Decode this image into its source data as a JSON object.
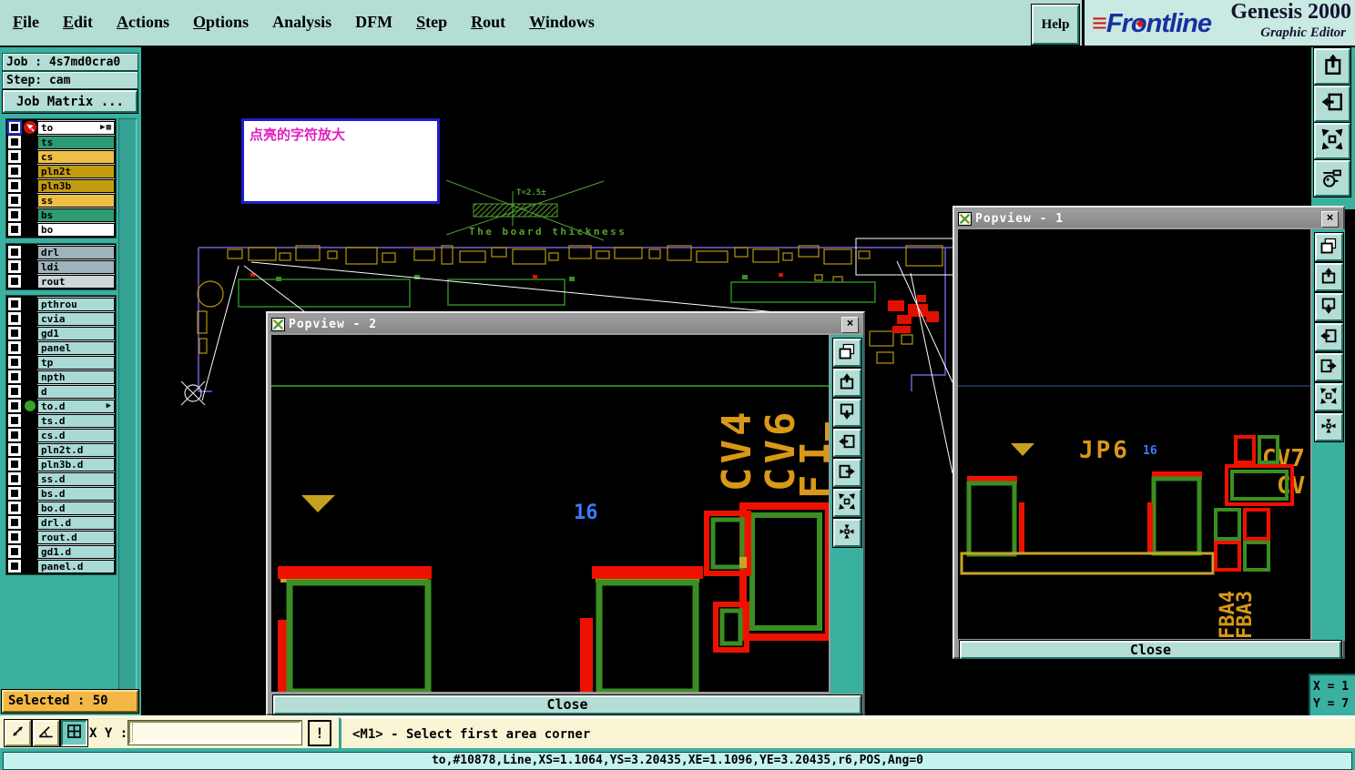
{
  "app": {
    "brand": "Frontline",
    "product": "Genesis 2000",
    "subtitle": "Graphic Editor",
    "help_label": "Help"
  },
  "menu": {
    "items": [
      {
        "label": "File",
        "ul": true
      },
      {
        "label": "Edit",
        "ul": true
      },
      {
        "label": "Actions",
        "ul": true
      },
      {
        "label": "Options",
        "ul": true
      },
      {
        "label": "Analysis",
        "ul": false
      },
      {
        "label": "DFM",
        "ul": false
      },
      {
        "label": "Step",
        "ul": true
      },
      {
        "label": "Rout",
        "ul": true
      },
      {
        "label": "Windows",
        "ul": true
      }
    ]
  },
  "job_panel": {
    "job": "Job : 4s7md0cra0",
    "step": "Step: cam",
    "matrix_button": "Job Matrix ..."
  },
  "layers": {
    "groups": [
      {
        "rows": [
          {
            "name": "to",
            "bg": "#FFFFFF",
            "active": true,
            "marker": "active-arrow-icon",
            "icons": [
              "pointer-icon",
              "grid-icon"
            ]
          },
          {
            "name": "ts",
            "bg": "#2E9B72"
          },
          {
            "name": "cs",
            "bg": "#EFBF45"
          },
          {
            "name": "pln2t",
            "bg": "#C49C10"
          },
          {
            "name": "pln3b",
            "bg": "#C49C10"
          },
          {
            "name": "ss",
            "bg": "#EFBF45"
          },
          {
            "name": "bs",
            "bg": "#2E9B72"
          },
          {
            "name": "bo",
            "bg": "#FFFFFF"
          }
        ]
      },
      {
        "rows": [
          {
            "name": "drl",
            "bg": "#9DB4BC"
          },
          {
            "name": "ldi",
            "bg": "#9DB4BC"
          },
          {
            "name": "rout",
            "bg": "#CDD6D8"
          }
        ]
      },
      {
        "rows": [
          {
            "name": "pthrou",
            "bg": "#A9DAD6"
          },
          {
            "name": "cvia",
            "bg": "#A9DAD6"
          },
          {
            "name": "gd1",
            "bg": "#A9DAD6"
          },
          {
            "name": "panel",
            "bg": "#A9DAD6"
          },
          {
            "name": "tp",
            "bg": "#A9DAD6"
          },
          {
            "name": "npth",
            "bg": "#A9DAD6"
          },
          {
            "name": "d",
            "bg": "#A9DAD6"
          },
          {
            "name": "to.d",
            "bg": "#A9DAD6",
            "marker": "active-dot-icon",
            "icons": [
              "pointer-icon"
            ]
          },
          {
            "name": "ts.d",
            "bg": "#A9DAD6"
          },
          {
            "name": "cs.d",
            "bg": "#A9DAD6"
          },
          {
            "name": "pln2t.d",
            "bg": "#A9DAD6"
          },
          {
            "name": "pln3b.d",
            "bg": "#A9DAD6"
          },
          {
            "name": "ss.d",
            "bg": "#A9DAD6"
          },
          {
            "name": "bs.d",
            "bg": "#A9DAD6"
          },
          {
            "name": "bo.d",
            "bg": "#A9DAD6"
          },
          {
            "name": "drl.d",
            "bg": "#A9DAD6"
          },
          {
            "name": "rout.d",
            "bg": "#A9DAD6"
          },
          {
            "name": "gd1.d",
            "bg": "#A9DAD6"
          },
          {
            "name": "panel.d",
            "bg": "#A9DAD6"
          }
        ]
      }
    ]
  },
  "selected_box": {
    "text": "Selected : 50"
  },
  "toolbar_right": {
    "buttons": [
      "page-up-icon",
      "pan-left-icon",
      "expand-icon",
      "tools-icon"
    ]
  },
  "canvas": {
    "note": "点亮的字符放大",
    "thickness_value": "T=2.5±",
    "thickness_caption": "The board thickness"
  },
  "popview2": {
    "title": "Popview - 2",
    "close_label": "Close",
    "buttons": [
      "window-copy-icon",
      "pan-up-icon",
      "pan-down-icon",
      "pan-left-icon",
      "pan-right-icon",
      "expand-icon",
      "center-icon"
    ],
    "labels": {
      "cv4": "CV4",
      "cv6": "CV6",
      "f1": "FI",
      "f2": "F",
      "num": "16"
    }
  },
  "popview1": {
    "title": "Popview - 1",
    "close_label": "Close",
    "buttons": [
      "window-copy-icon",
      "pan-up-icon",
      "pan-down-icon",
      "pan-left-icon",
      "pan-right-icon",
      "expand-icon",
      "center-icon"
    ],
    "labels": {
      "jp6": "JP6",
      "num": "16",
      "cv7": "CV7",
      "cv": "CV",
      "fba4": "FBA4",
      "fba3": "FBA3"
    }
  },
  "command_bar": {
    "buttons": [
      {
        "icon": "measure-icon"
      },
      {
        "icon": "angle-icon"
      },
      {
        "icon": "grid-icon",
        "pressed": true
      }
    ],
    "xy_label": "X Y :",
    "xy_value": "",
    "alert_label": "!",
    "message": "<M1> - Select first area corner"
  },
  "status_bar": {
    "text": "to,#10878,Line,XS=1.1064,YS=3.20435,XE=1.1096,YE=3.20435,r6,POS,Ang=0"
  },
  "coord_box": {
    "x": "X = 1",
    "y": "Y = 7"
  },
  "colors": {
    "frame_teal": "#3AB0A1",
    "panel_light": "#B4DDD6",
    "selected_orange": "#F2B845",
    "command_cream": "#F9F5D4",
    "status_cyan": "#C4F2EE",
    "pcb_gold": "#C8A428",
    "pcb_green": "#3A8F22",
    "pcb_red": "#EE1100",
    "label_orange": "#D89818",
    "label_blue": "#3B7BFF",
    "board_outline_purple": "#7A5FD0",
    "note_magenta": "#E020C0",
    "annotation_green": "#55A030"
  }
}
